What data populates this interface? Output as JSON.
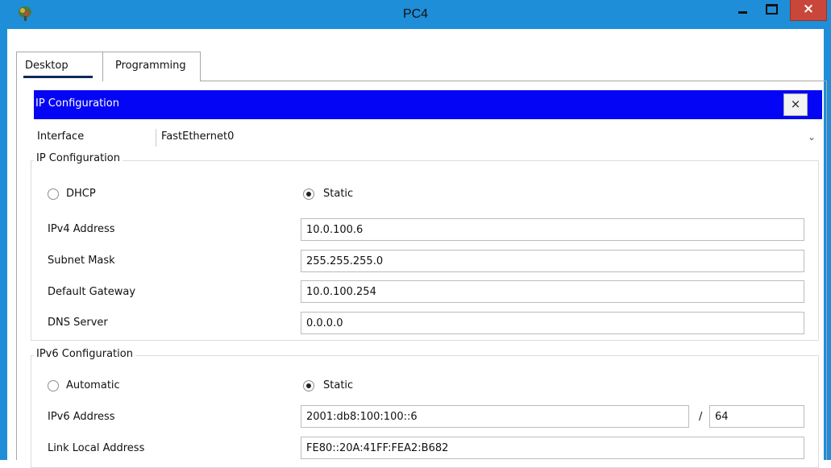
{
  "window": {
    "title": "PC4",
    "close_glyph": "×",
    "colors": {
      "titlebar": "#1e8ed8",
      "close": "#c9473a"
    }
  },
  "tabs": [
    {
      "label": "Desktop",
      "active": true
    },
    {
      "label": "Programming",
      "active": false
    }
  ],
  "panel": {
    "title": "IP Configuration",
    "close_glyph": "×",
    "header_color": "#0505f5",
    "interface": {
      "label": "Interface",
      "value": "FastEthernet0"
    }
  },
  "ipv4": {
    "group_title": "IP Configuration",
    "mode": {
      "dhcp_label": "DHCP",
      "static_label": "Static",
      "selected": "Static"
    },
    "fields": [
      {
        "label": "IPv4 Address",
        "value": "10.0.100.6"
      },
      {
        "label": "Subnet Mask",
        "value": "255.255.255.0"
      },
      {
        "label": "Default Gateway",
        "value": "10.0.100.254"
      },
      {
        "label": "DNS Server",
        "value": "0.0.0.0"
      }
    ]
  },
  "ipv6": {
    "group_title": "IPv6 Configuration",
    "mode": {
      "auto_label": "Automatic",
      "static_label": "Static",
      "selected": "Static"
    },
    "address": {
      "label": "IPv6 Address",
      "value": "2001:db8:100:100::6",
      "separator": "/",
      "prefix": "64"
    },
    "link_local": {
      "label": "Link Local Address",
      "value": "FE80::20A:41FF:FEA2:B682"
    }
  }
}
